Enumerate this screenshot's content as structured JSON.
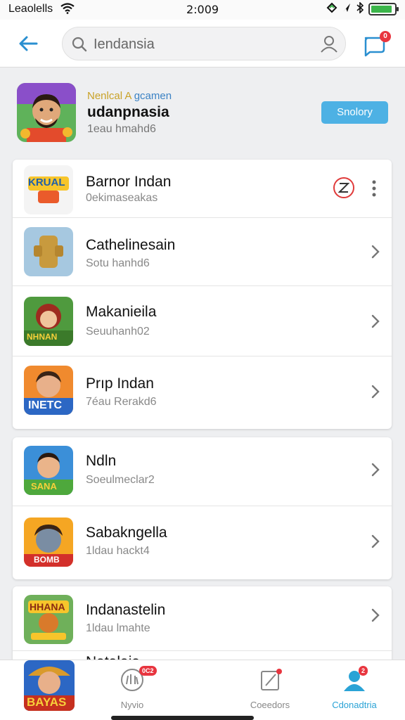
{
  "status": {
    "carrier": "Leaolells",
    "time": "2:009",
    "battery_level": 0.9
  },
  "header": {
    "search_text": "Iendansia",
    "chat_badge": "0"
  },
  "profile": {
    "tag_part1": "Nenlcal A",
    "tag_part2": "gcamen",
    "name": "udanpnasia",
    "subtitle": "1eau hmahd6",
    "button_label": "Snolory"
  },
  "list1": [
    {
      "title": "Barnor Indan",
      "subtitle": "0ekimaseakas",
      "thumb_text": "KRUAL"
    },
    {
      "title": "Cathelinesain",
      "subtitle": "Sotu hanhd6",
      "thumb_text": ""
    },
    {
      "title": "Makanieila",
      "subtitle": "Seuuhanh02",
      "thumb_text": "NHNAN"
    },
    {
      "title": "Prıp Indan",
      "subtitle": "7éau Rerakd6",
      "thumb_text": "INETC"
    }
  ],
  "list2": [
    {
      "title": "Ndln",
      "subtitle": "Soeulmeclar2",
      "thumb_text": "SANA"
    },
    {
      "title": "Sabakngella",
      "subtitle": "1ldau hackt4",
      "thumb_text": "BOMB"
    }
  ],
  "list3": [
    {
      "title": "Indanastelin",
      "subtitle": "1ldau lmahte",
      "thumb_text": "HHANA"
    },
    {
      "title": "Natalaia"
    }
  ],
  "tabbar": {
    "tab1_thumb_text": "BAYAS",
    "tab2_label": "Nyvio",
    "tab2_badge": "0C2",
    "tab3_label": "Coeedors",
    "tab4_label": "Cdonadtria",
    "tab4_badge": "2"
  },
  "colors": {
    "accent": "#4db1e4",
    "badge": "#e8353f",
    "active_tab": "#2aa3d6",
    "back_arrow": "#2a8fd0"
  }
}
